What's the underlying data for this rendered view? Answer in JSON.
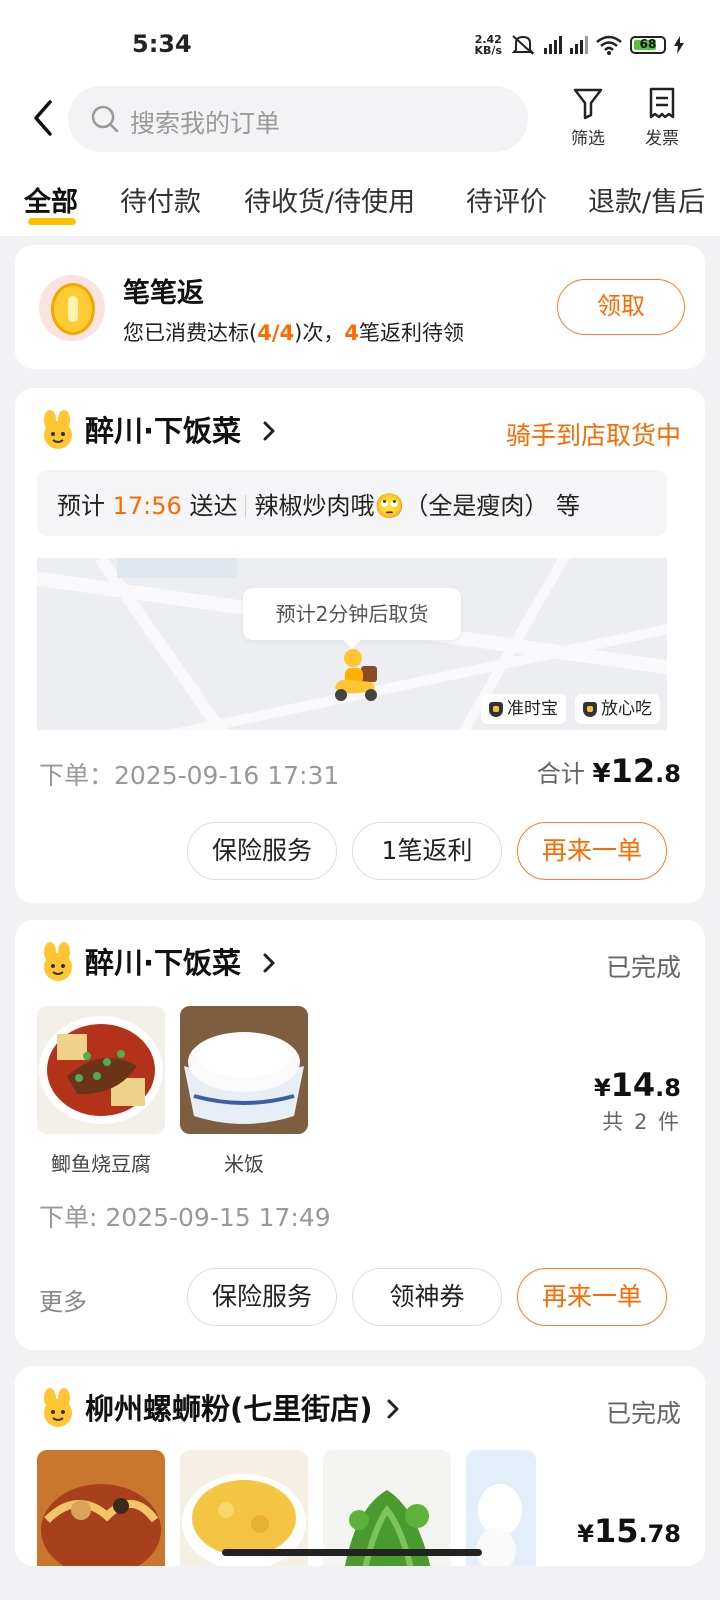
{
  "status_bar": {
    "time": "5:34",
    "speed_value": "2.42",
    "speed_unit": "KB/s",
    "battery": "68"
  },
  "header": {
    "search_placeholder": "搜索我的订单",
    "filter_label": "筛选",
    "invoice_label": "发票"
  },
  "tabs": [
    {
      "label": "全部",
      "active": true
    },
    {
      "label": "待付款"
    },
    {
      "label": "待收货/待使用"
    },
    {
      "label": "待评价"
    },
    {
      "label": "退款/售后"
    }
  ],
  "reward": {
    "title": "笔笔返",
    "sub_prefix": "您已消费达标(",
    "count_a": "4",
    "slash": "/",
    "count_b": "4",
    "sub_mid": ")次，",
    "count_c": "4",
    "sub_suffix": "笔返利待领",
    "button": "领取"
  },
  "orders": [
    {
      "shop": "醉川·下饭菜",
      "status": "骑手到店取货中",
      "eta_prefix": "预计",
      "eta_time": "17:56",
      "eta_suffix": "送达",
      "items_summary": "辣椒炒肉哦🙄（全是瘦肉） 等",
      "map_bubble": "预计2分钟后取货",
      "map_tags": [
        "准时宝",
        "放心吃"
      ],
      "order_time": "下单：2025-09-16 17:31",
      "total_label": "合计",
      "total_yuan": "¥",
      "total_int": "12",
      "total_dec": ".8",
      "buttons": [
        "保险服务",
        "1笔返利",
        "再来一单"
      ]
    },
    {
      "shop": "醉川·下饭菜",
      "status": "已完成",
      "items": [
        "鲫鱼烧豆腐",
        "米饭"
      ],
      "price_yuan": "¥",
      "price_int": "14",
      "price_dec": ".8",
      "count": "共 2 件",
      "order_time": "下单: 2025-09-15 17:49",
      "more": "更多",
      "buttons": [
        "保险服务",
        "领神券",
        "再来一单"
      ]
    },
    {
      "shop": "柳州螺蛳粉(七里街店)",
      "status": "已完成",
      "price_yuan": "¥",
      "price_int": "15",
      "price_dec": ".78"
    }
  ],
  "colors": {
    "accent": "#ff6a00",
    "tab_underline": "#ffc200",
    "background": "#f2f2f4"
  }
}
